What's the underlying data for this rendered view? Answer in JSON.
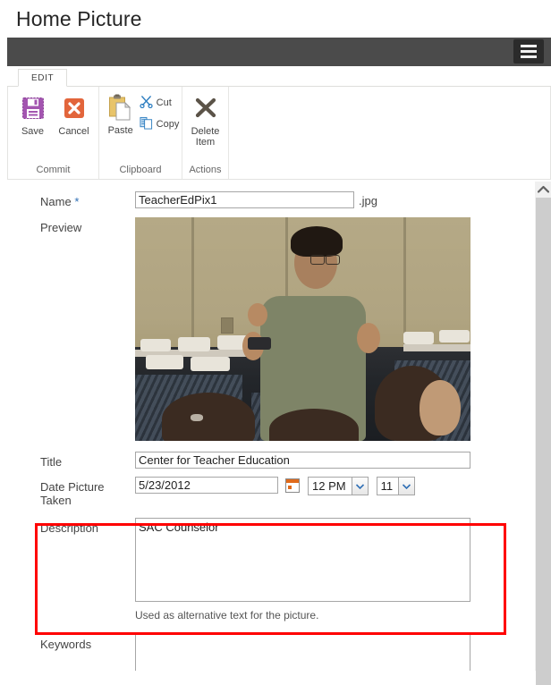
{
  "page": {
    "title": "Home Picture"
  },
  "suite_bar": {
    "menu_icon": "hamburger-menu-icon"
  },
  "ribbon": {
    "tabs": [
      {
        "label": "EDIT",
        "active": true
      }
    ],
    "groups": [
      {
        "name": "Commit",
        "label": "Commit",
        "buttons": [
          {
            "label": "Save",
            "icon": "save-floppy-icon",
            "color": "#a355b0"
          },
          {
            "label": "Cancel",
            "icon": "cancel-x-icon",
            "color": "#e2653b"
          }
        ]
      },
      {
        "name": "Clipboard",
        "label": "Clipboard",
        "buttons": [
          {
            "label": "Paste",
            "icon": "paste-clipboard-icon",
            "color": "#e8c46a"
          },
          {
            "label": "Cut",
            "icon": "scissors-icon",
            "color": "#2f7fc1"
          },
          {
            "label": "Copy",
            "icon": "copy-pages-icon",
            "color": "#2f7fc1"
          }
        ]
      },
      {
        "name": "Actions",
        "label": "Actions",
        "buttons": [
          {
            "label": "Delete Item",
            "icon": "delete-x-icon",
            "color": "#5b5348"
          }
        ]
      }
    ]
  },
  "form": {
    "fields": {
      "name": {
        "label": "Name",
        "required_marker": "*",
        "value": "TeacherEdPix1",
        "extension": ".jpg"
      },
      "preview": {
        "label": "Preview",
        "alt": "Man in olive shirt speaking to a seated audience in a classroom"
      },
      "title": {
        "label": "Title",
        "value": "Center for Teacher Education"
      },
      "date_picture_taken": {
        "label": "Date Picture Taken",
        "value": "5/23/2012",
        "calendar_icon": "calendar-icon",
        "hour": "12 PM",
        "minute": "11"
      },
      "description": {
        "label": "Description",
        "value": "SAC Counselor",
        "hint": "Used as alternative text for the picture.",
        "highlight_color": "#ff0000"
      },
      "keywords": {
        "label": "Keywords",
        "value": ""
      }
    }
  },
  "scrollbar": {
    "up_arrow": "chevron-up-icon"
  }
}
